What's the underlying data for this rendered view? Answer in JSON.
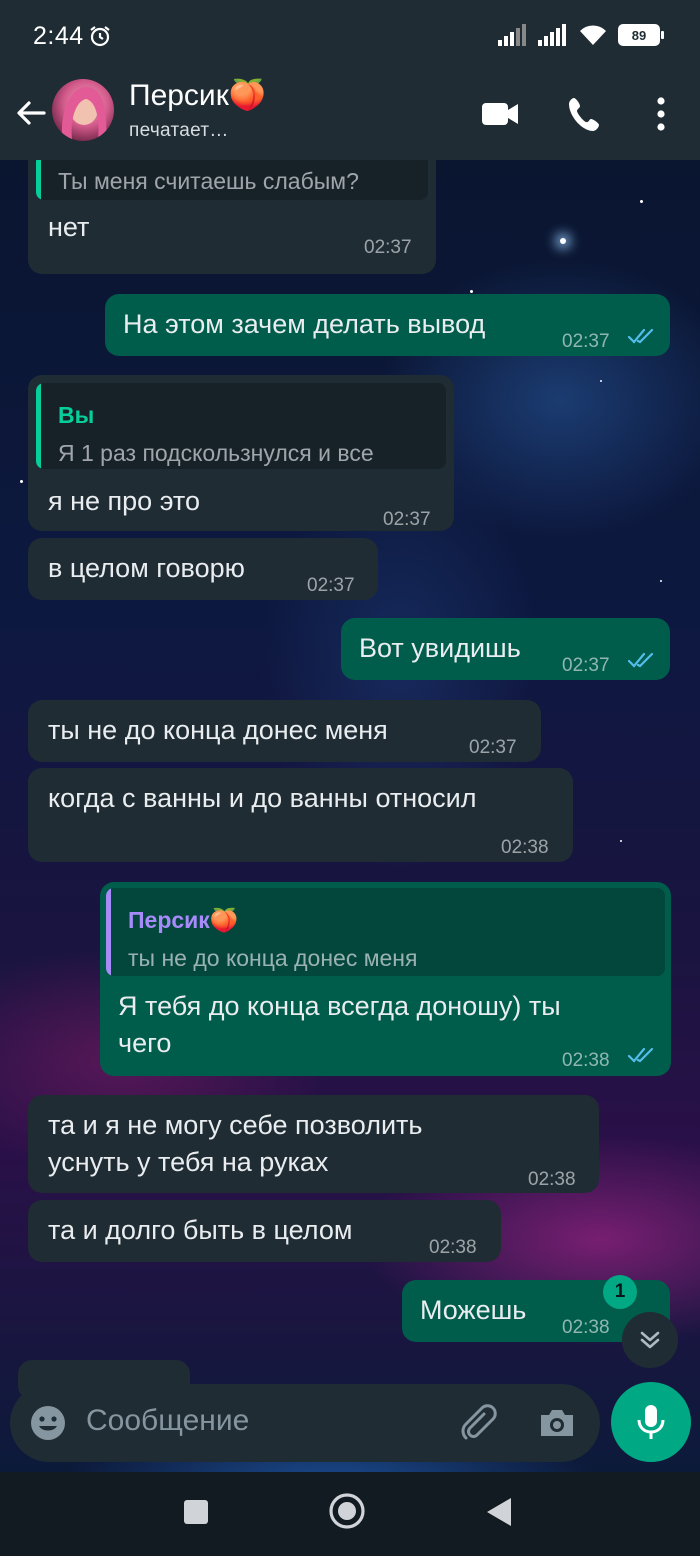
{
  "status_bar": {
    "time": "2:44",
    "battery": "89"
  },
  "header": {
    "contact_name": "Персик🍑",
    "contact_status": "печатает…"
  },
  "messages": [
    {
      "quote_text": "Ты меня считаешь слабым?",
      "text": "нет",
      "time": "02:37"
    },
    {
      "text": "На этом зачем делать вывод",
      "time": "02:37"
    },
    {
      "quote_name": "Вы",
      "quote_text": "Я 1 раз подскользнулся и все",
      "text": "я не про это",
      "time": "02:37"
    },
    {
      "text": "в целом говорю",
      "time": "02:37"
    },
    {
      "text": "Вот увидишь",
      "time": "02:37"
    },
    {
      "text": "ты не до конца донес меня",
      "time": "02:37"
    },
    {
      "text": "когда с ванны и до ванны относил",
      "time": "02:38"
    },
    {
      "quote_name": "Персик🍑",
      "quote_text": "ты не до конца донес меня",
      "text_line1": "Я тебя до конца всегда доношу) ты",
      "text_line2": "чего",
      "time": "02:38"
    },
    {
      "text_line1": "та и я не могу себе позволить",
      "text_line2": "уснуть у тебя на руках",
      "time": "02:38"
    },
    {
      "text": "та и долго быть в целом",
      "time": "02:38"
    },
    {
      "text": "Можешь",
      "time": "02:38"
    }
  ],
  "unread_count": "1",
  "composer": {
    "placeholder": "Сообщение"
  },
  "colors": {
    "incoming": "#1f2c34",
    "outgoing": "#005c4b",
    "accent": "#00a884",
    "read_tick": "#53bdeb"
  },
  "icons": [
    "alarm-icon",
    "signal-icon",
    "wifi-icon",
    "battery-icon",
    "back-arrow-icon",
    "video-call-icon",
    "phone-icon",
    "more-icon",
    "double-tick-icon",
    "chevron-double-down-icon",
    "emoji-icon",
    "attach-icon",
    "camera-icon",
    "mic-icon",
    "nav-square-icon",
    "nav-circle-icon",
    "nav-back-icon"
  ]
}
